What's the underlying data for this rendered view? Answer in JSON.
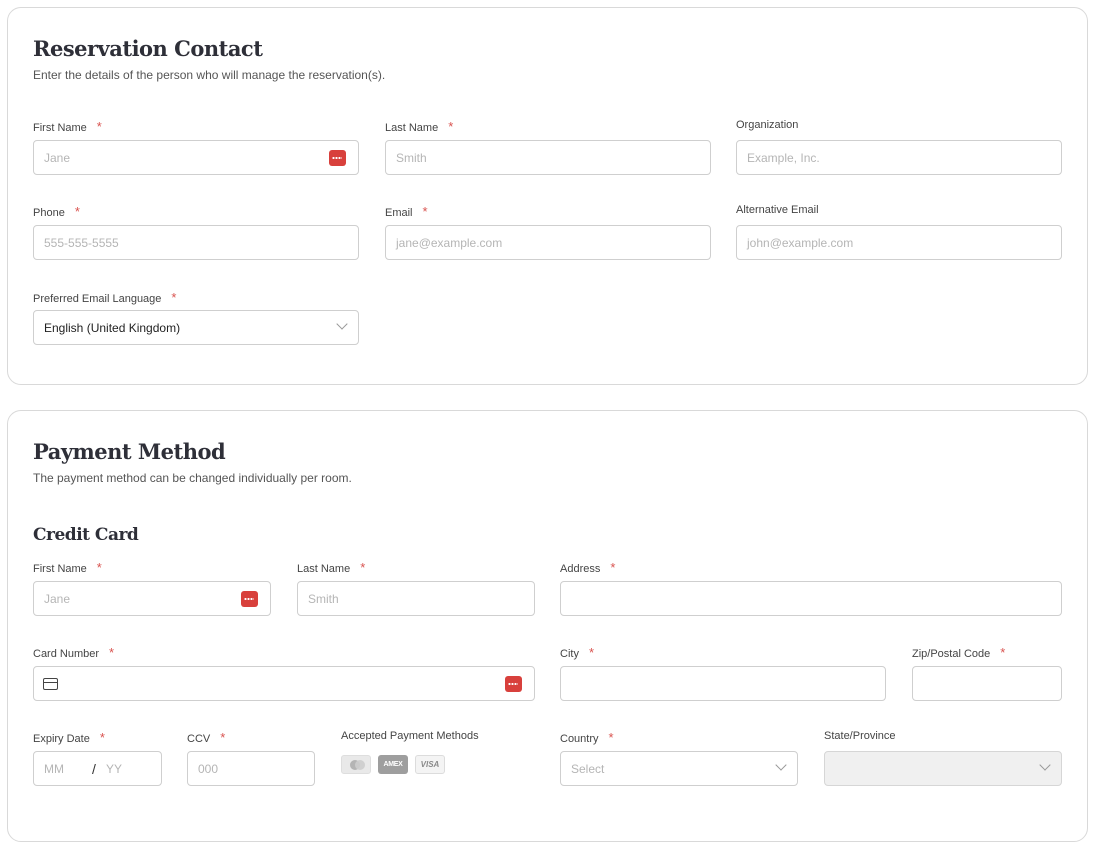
{
  "contact": {
    "title": "Reservation Contact",
    "subtitle": "Enter the details of the person who will manage the reservation(s).",
    "first_name": {
      "label": "First Name",
      "placeholder": "Jane"
    },
    "last_name": {
      "label": "Last Name",
      "placeholder": "Smith"
    },
    "organization": {
      "label": "Organization",
      "placeholder": "Example, Inc."
    },
    "phone": {
      "label": "Phone",
      "placeholder": "555-555-5555"
    },
    "email": {
      "label": "Email",
      "placeholder": "jane@example.com"
    },
    "alt_email": {
      "label": "Alternative Email",
      "placeholder": "john@example.com"
    },
    "language": {
      "label": "Preferred Email Language",
      "value": "English (United Kingdom)"
    }
  },
  "payment": {
    "title": "Payment Method",
    "subtitle": "The payment method can be changed individually per room.",
    "section_title": "Credit Card",
    "first_name": {
      "label": "First Name",
      "placeholder": "Jane"
    },
    "last_name": {
      "label": "Last Name",
      "placeholder": "Smith"
    },
    "address": {
      "label": "Address",
      "placeholder": ""
    },
    "card_number": {
      "label": "Card Number",
      "placeholder": ""
    },
    "city": {
      "label": "City",
      "placeholder": ""
    },
    "zip": {
      "label": "Zip/Postal Code",
      "placeholder": ""
    },
    "expiry": {
      "label": "Expiry Date",
      "mm": "MM",
      "slash": "/",
      "yy": "YY"
    },
    "ccv": {
      "label": "CCV",
      "placeholder": "000"
    },
    "accepted": {
      "label": "Accepted Payment Methods",
      "amex": "AMEX",
      "visa": "VISA"
    },
    "country": {
      "label": "Country",
      "placeholder": "Select"
    },
    "state": {
      "label": "State/Province",
      "value": ""
    }
  },
  "required_mark": "*",
  "icons": {
    "password_manager": "password-manager-icon",
    "credit_card": "credit-card-icon",
    "dropdown": "chevron-down-icon"
  },
  "colors": {
    "required": "#d9534f",
    "password_manager": "#d8403c",
    "border": "#cfcfcf"
  }
}
